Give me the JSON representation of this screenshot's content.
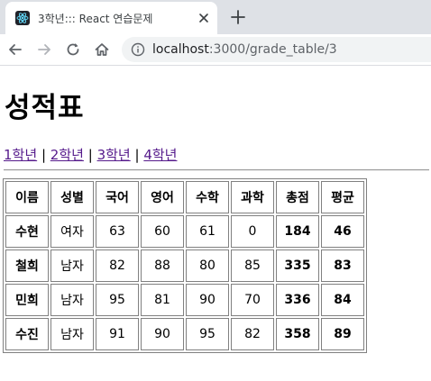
{
  "browser": {
    "tab_title": "3학년::: React 연습문제",
    "url_host": "localhost",
    "url_path": ":3000/grade_table/3"
  },
  "page": {
    "title": "성적표",
    "grade_links": [
      "1학년",
      "2학년",
      "3학년",
      "4학년"
    ],
    "separator": "|"
  },
  "table": {
    "headers": [
      "이름",
      "성별",
      "국어",
      "영어",
      "수학",
      "과학",
      "총점",
      "평균"
    ],
    "rows": [
      {
        "name": "수현",
        "gender": "여자",
        "korean": "63",
        "english": "60",
        "math": "61",
        "science": "0",
        "total": "184",
        "avg": "46"
      },
      {
        "name": "철희",
        "gender": "남자",
        "korean": "82",
        "english": "88",
        "math": "80",
        "science": "85",
        "total": "335",
        "avg": "83"
      },
      {
        "name": "민희",
        "gender": "남자",
        "korean": "95",
        "english": "81",
        "math": "90",
        "science": "70",
        "total": "336",
        "avg": "84"
      },
      {
        "name": "수진",
        "gender": "남자",
        "korean": "91",
        "english": "90",
        "math": "95",
        "science": "82",
        "total": "358",
        "avg": "89"
      }
    ]
  },
  "icons": {
    "favicon": "react-icon",
    "close": "close-icon",
    "new_tab": "plus-icon",
    "back": "back-arrow-icon",
    "forward": "forward-arrow-icon",
    "reload": "reload-icon",
    "home": "home-icon",
    "info": "info-icon"
  },
  "colors": {
    "tabstrip": "#dee1e6",
    "visited_link": "#551a8b",
    "table_border": "#808080"
  }
}
